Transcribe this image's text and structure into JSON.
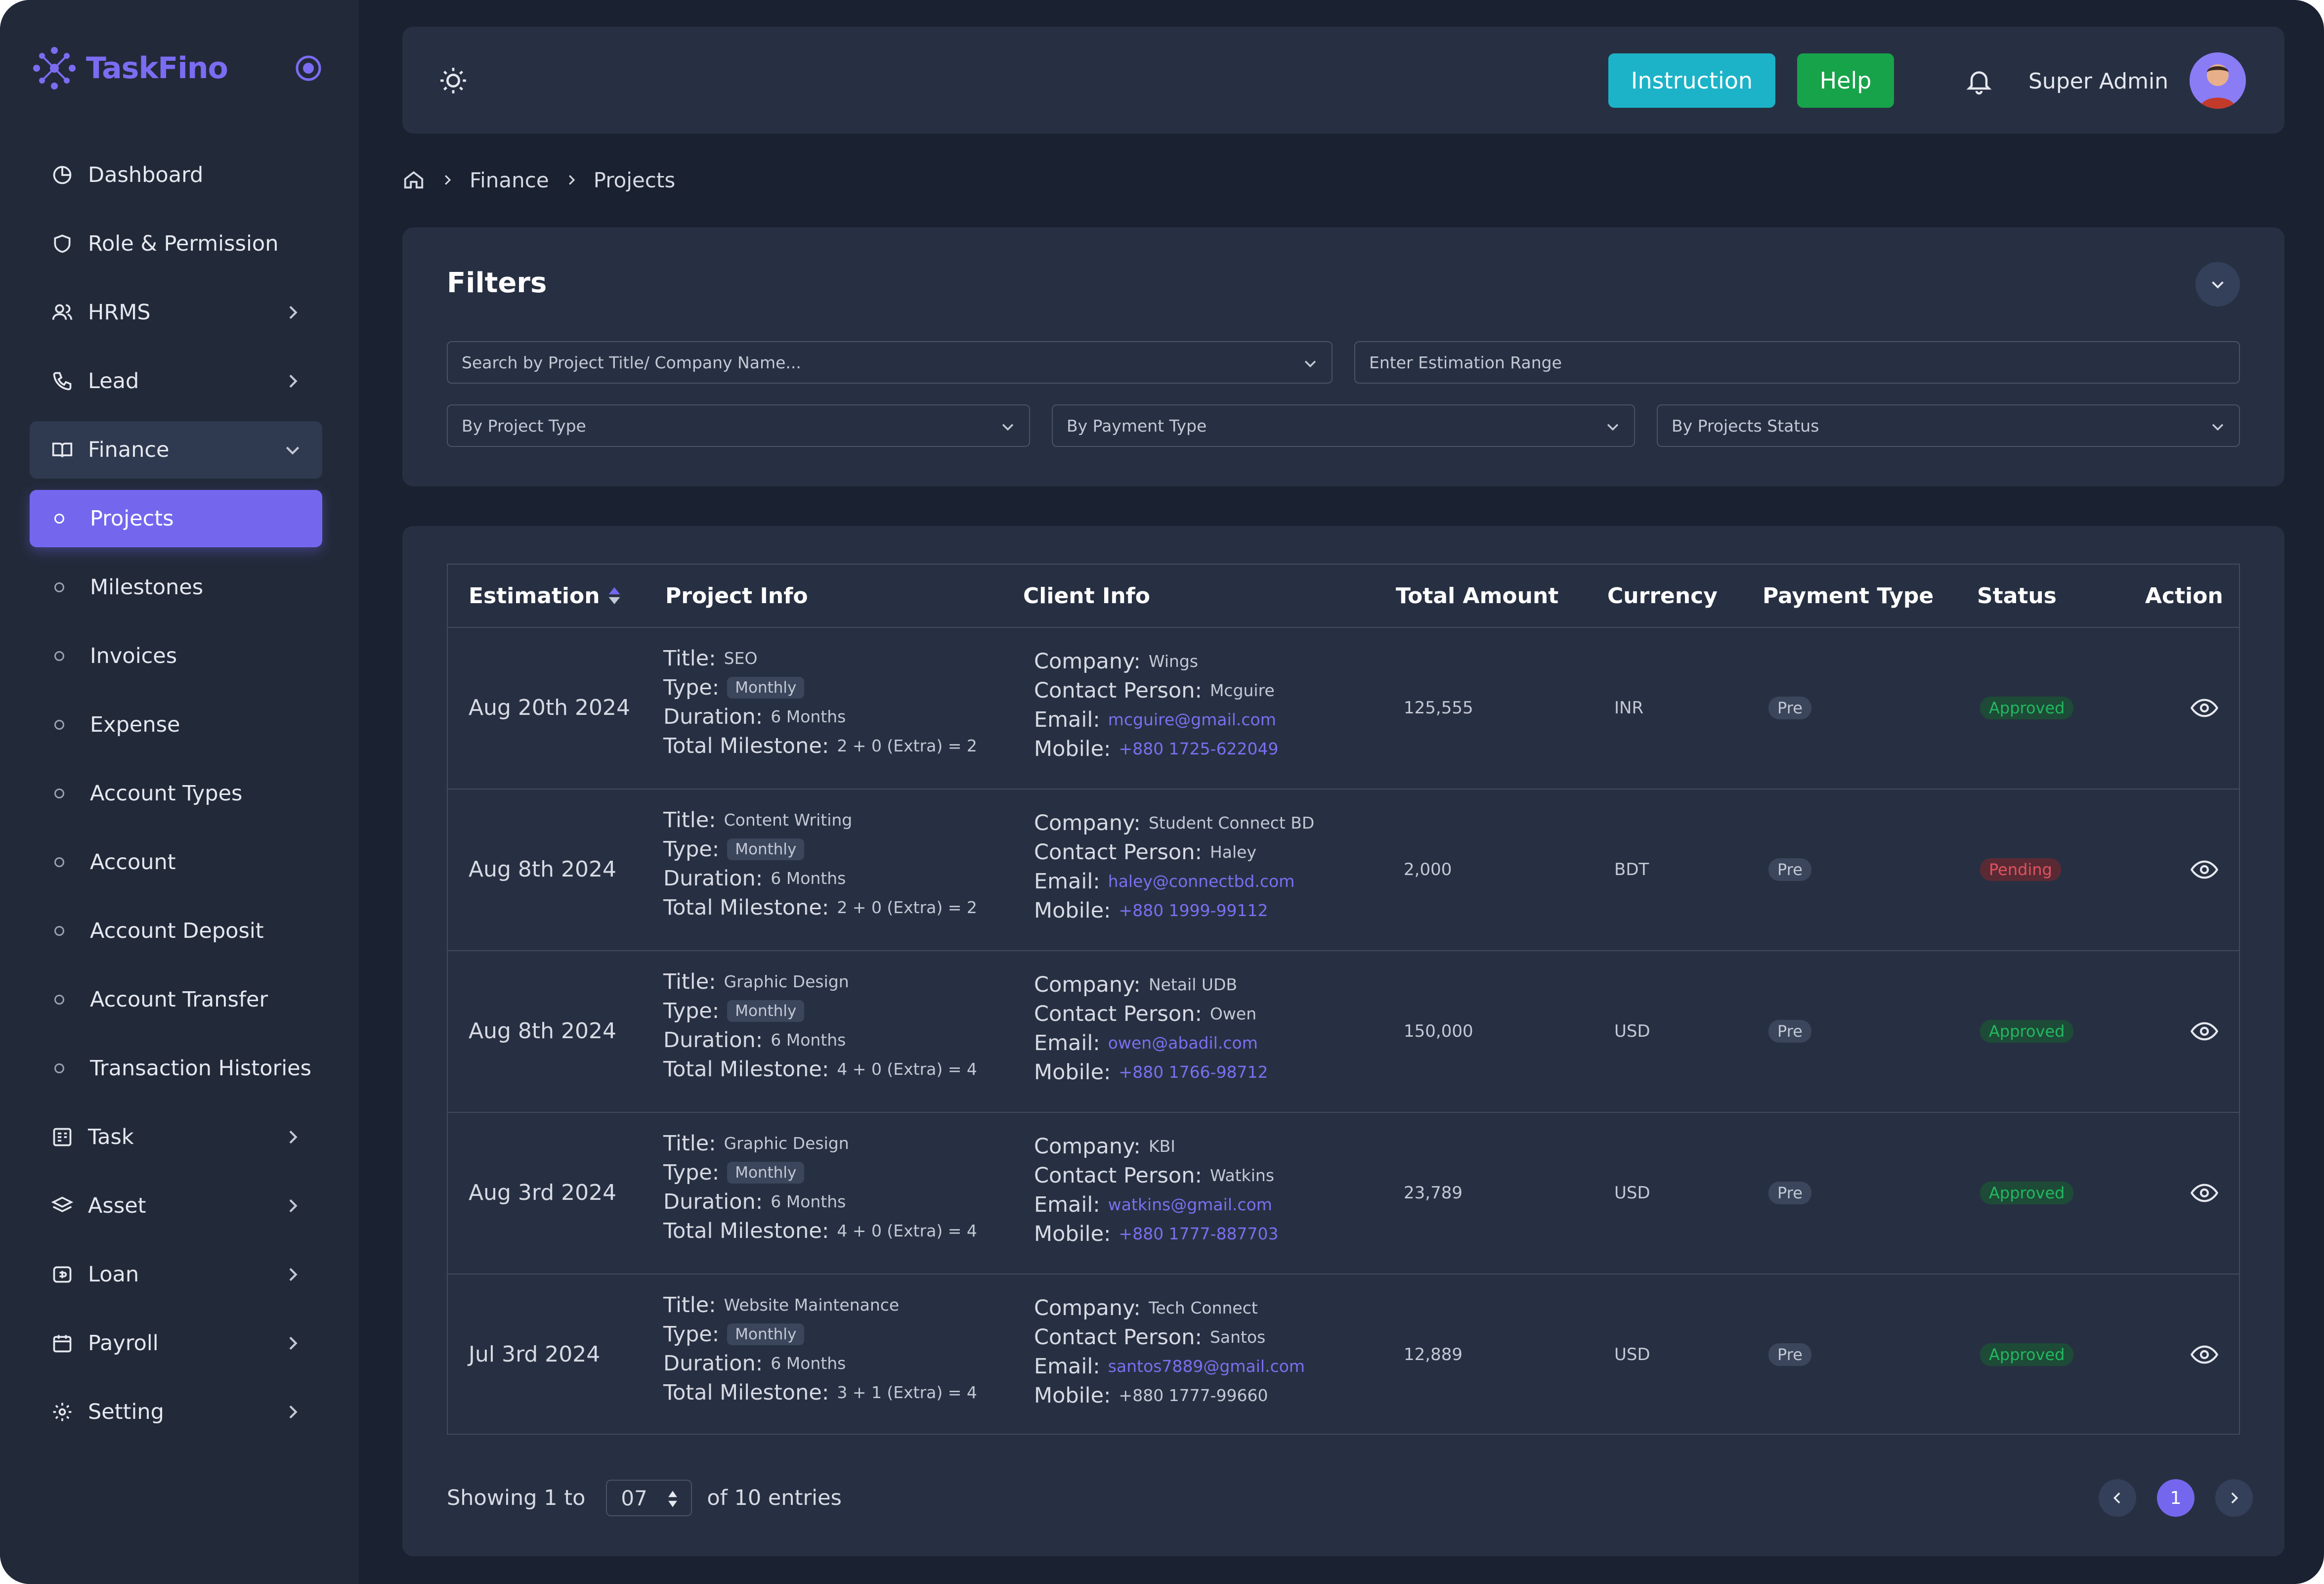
{
  "app": {
    "name": "TaskFino"
  },
  "colors": {
    "accent": "#7467ee",
    "instruction": "#1cb3c8",
    "help": "#17a34a",
    "approved": "#22b860",
    "pending": "#e0525f",
    "link": "#7a6ff0"
  },
  "sidebar": {
    "items": [
      {
        "label": "Dashboard",
        "icon": "dashboard-icon"
      },
      {
        "label": "Role & Permission",
        "icon": "shield-icon"
      },
      {
        "label": "HRMS",
        "icon": "users-icon",
        "has_children": true
      },
      {
        "label": "Lead",
        "icon": "phone-icon",
        "has_children": true
      },
      {
        "label": "Finance",
        "icon": "book-icon",
        "expanded": true
      },
      {
        "label": "Projects",
        "active": true
      },
      {
        "label": "Milestones"
      },
      {
        "label": "Invoices"
      },
      {
        "label": "Expense"
      },
      {
        "label": "Account Types"
      },
      {
        "label": "Account"
      },
      {
        "label": "Account Deposit"
      },
      {
        "label": "Account Transfer"
      },
      {
        "label": "Transaction Histories"
      },
      {
        "label": "Task",
        "icon": "task-icon",
        "has_children": true
      },
      {
        "label": "Asset",
        "icon": "layers-icon",
        "has_children": true
      },
      {
        "label": "Loan",
        "icon": "loan-icon",
        "has_children": true
      },
      {
        "label": "Payroll",
        "icon": "calendar-icon",
        "has_children": true
      },
      {
        "label": "Setting",
        "icon": "gear-icon",
        "has_children": true
      }
    ]
  },
  "header": {
    "instruction_label": "Instruction",
    "help_label": "Help",
    "user_name": "Super Admin"
  },
  "breadcrumb": [
    "Finance",
    "Projects"
  ],
  "filters": {
    "title": "Filters",
    "search_placeholder": "Search by Project Title/ Company Name...",
    "estimation_placeholder": "Enter Estimation Range",
    "project_type_placeholder": "By Project Type",
    "payment_type_placeholder": "By Payment Type",
    "status_placeholder": "By Projects Status"
  },
  "table": {
    "columns": [
      "Estimation",
      "Project Info",
      "Client Info",
      "Total Amount",
      "Currency",
      "Payment Type",
      "Status",
      "Action"
    ],
    "labels": {
      "title": "Title:",
      "type": "Type:",
      "duration": "Duration:",
      "total_milestone": "Total Milestone:",
      "company": "Company:",
      "contact": "Contact Person:",
      "email": "Email:",
      "mobile": "Mobile:"
    },
    "rows": [
      {
        "estimation": "Aug 20th 2024",
        "title": "SEO",
        "type": "Monthly",
        "duration": "6 Months",
        "milestone": "2 + 0 (Extra) = 2",
        "company": "Wings",
        "contact": "Mcguire",
        "email": "mcguire@gmail.com",
        "mobile": "+880 1725-622049",
        "amount": "125,555",
        "currency": "INR",
        "payment": "Pre",
        "status": "Approved"
      },
      {
        "estimation": "Aug 8th 2024",
        "title": "Content Writing",
        "type": "Monthly",
        "duration": "6 Months",
        "milestone": "2 + 0 (Extra) = 2",
        "company": "Student Connect BD",
        "contact": "Haley",
        "email": "haley@connectbd.com",
        "mobile": "+880 1999-99112",
        "amount": "2,000",
        "currency": "BDT",
        "payment": "Pre",
        "status": "Pending"
      },
      {
        "estimation": "Aug 8th 2024",
        "title": "Graphic Design",
        "type": "Monthly",
        "duration": "6 Months",
        "milestone": "4 + 0 (Extra) = 4",
        "company": "Netail UDB",
        "contact": "Owen",
        "email": "owen@abadil.com",
        "mobile": "+880 1766-98712",
        "amount": "150,000",
        "currency": "USD",
        "payment": "Pre",
        "status": "Approved"
      },
      {
        "estimation": "Aug 3rd 2024",
        "title": "Graphic Design",
        "type": "Monthly",
        "duration": "6 Months",
        "milestone": "4 + 0 (Extra) = 4",
        "company": "KBI",
        "contact": "Watkins",
        "email": "watkins@gmail.com",
        "mobile": "+880 1777-887703",
        "amount": "23,789",
        "currency": "USD",
        "payment": "Pre",
        "status": "Approved"
      },
      {
        "estimation": "Jul 3rd 2024",
        "title": "Website Maintenance",
        "type": "Monthly",
        "duration": "6 Months",
        "milestone": "3 + 1 (Extra) = 4",
        "company": "Tech Connect",
        "contact": "Santos",
        "email": "santos7889@gmail.com",
        "mobile": "+880 1777-99660",
        "amount": "12,889",
        "currency": "USD",
        "payment": "Pre",
        "status": "Approved"
      }
    ]
  },
  "pagination": {
    "showing_prefix": "Showing 1 to",
    "page_size": "07",
    "showing_suffix": "of 10 entries",
    "current_page": "1"
  }
}
